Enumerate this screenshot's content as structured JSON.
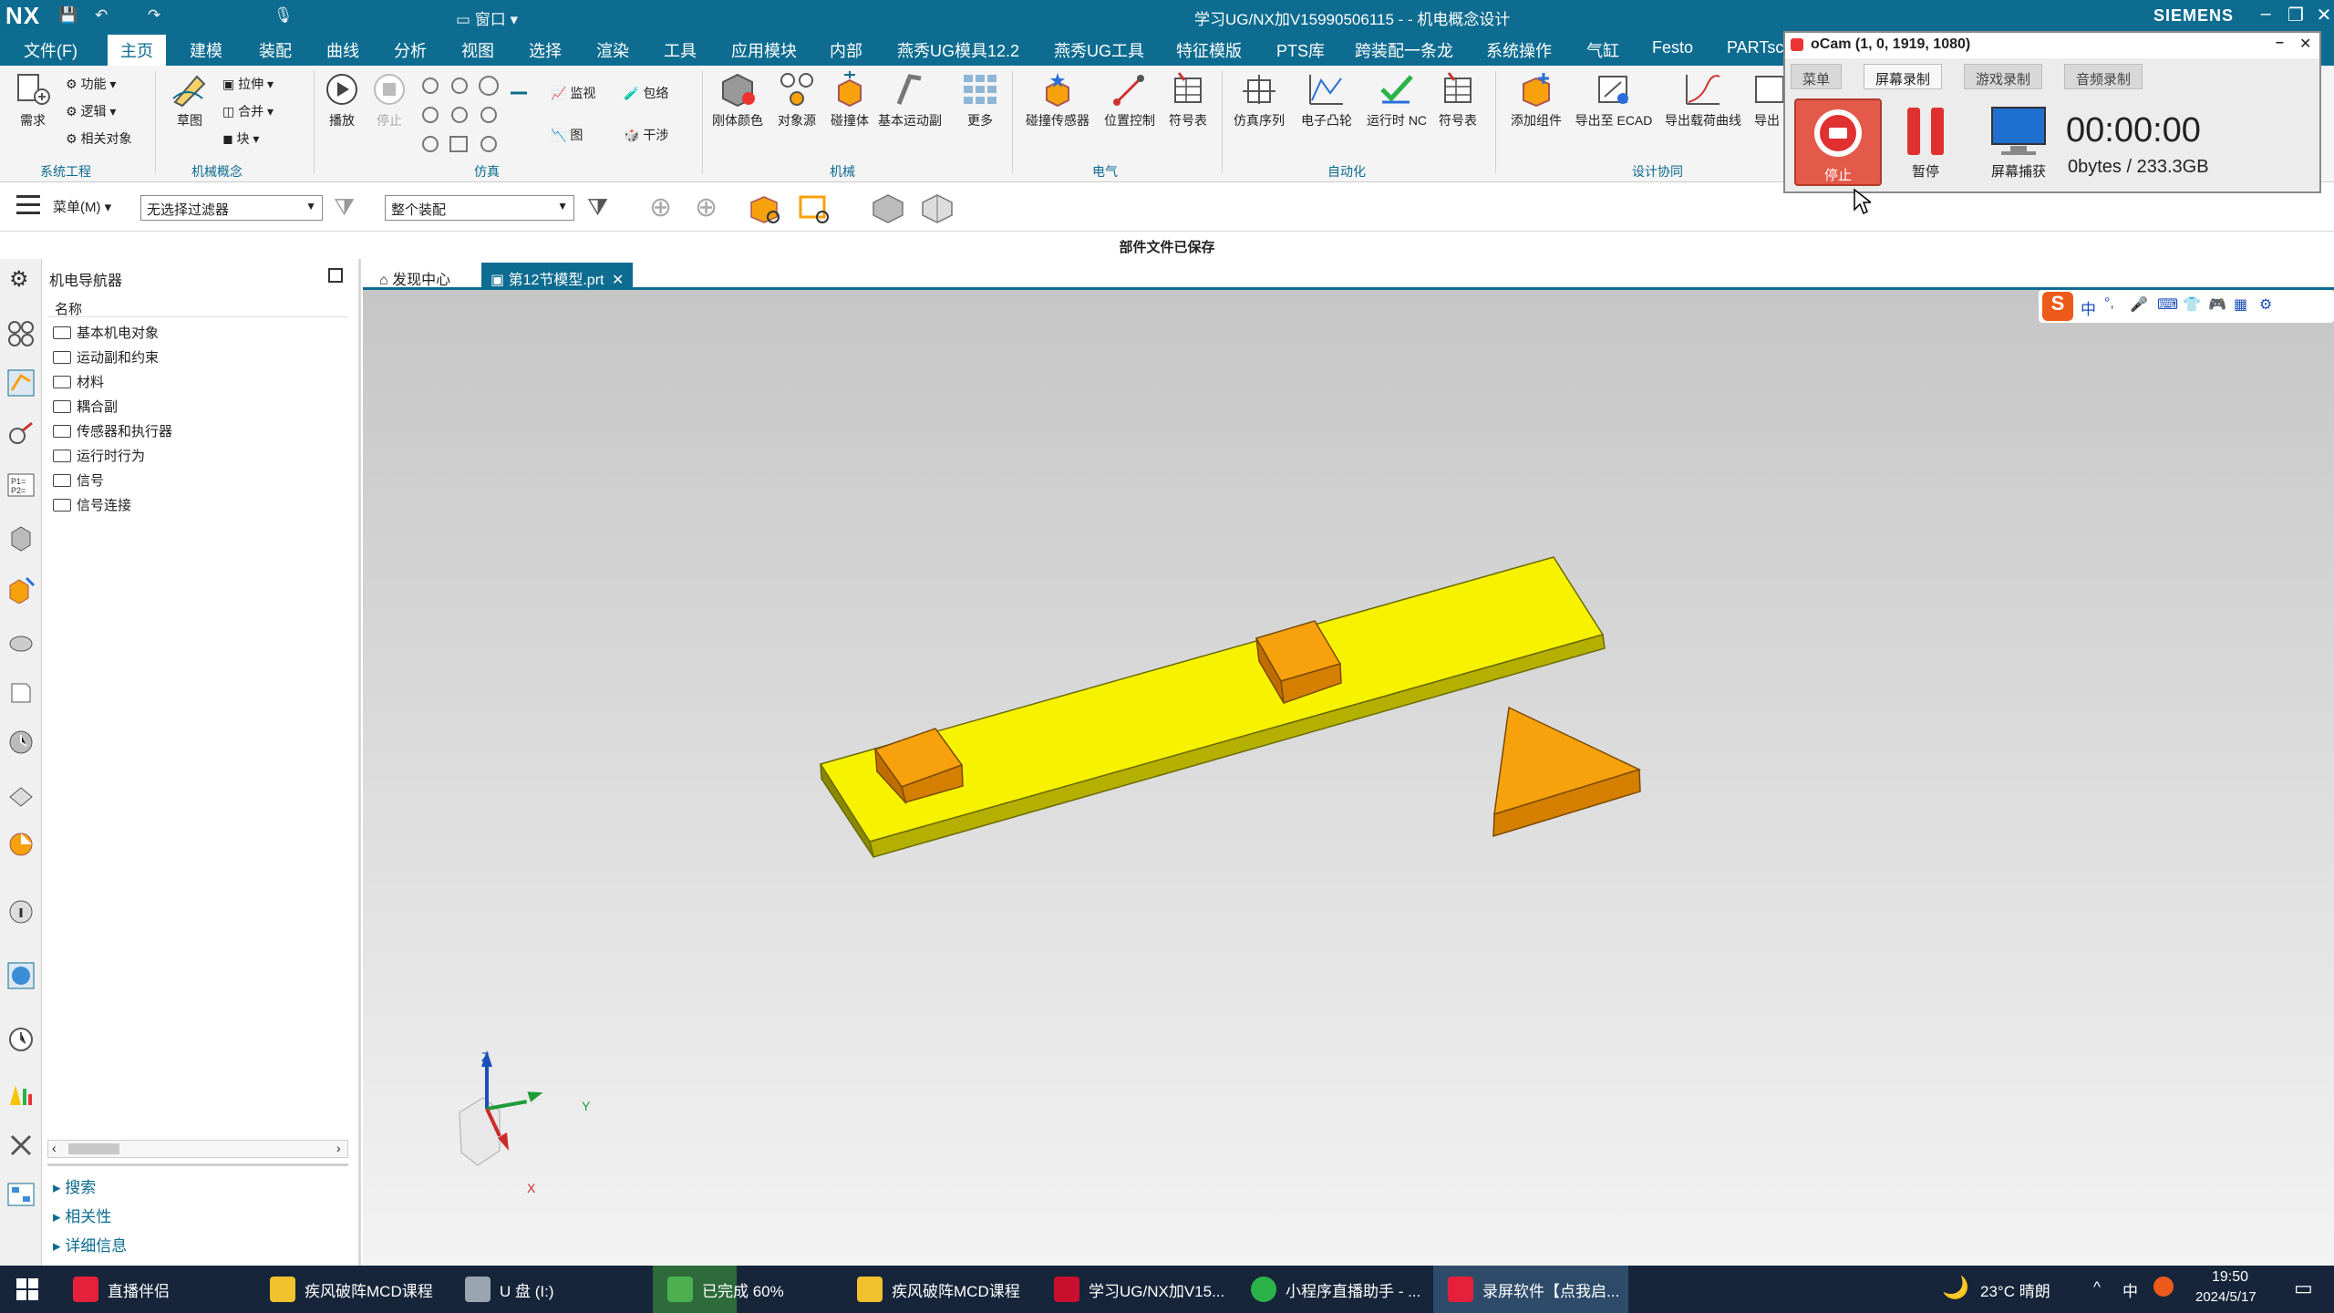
{
  "titlebar": {
    "logo": "NX",
    "title": "学习UG/NX加V15990506115 - - 机电概念设计",
    "brand": "SIEMENS",
    "quick_window": "窗口"
  },
  "menu": {
    "file": "文件(F)",
    "tabs": [
      "主页",
      "建模",
      "装配",
      "曲线",
      "分析",
      "视图",
      "选择",
      "渲染",
      "工具",
      "应用模块",
      "内部",
      "燕秀UG模具12.2",
      "燕秀UG工具",
      "特征模版",
      "PTS库",
      "跨装配一条龙",
      "系统操作",
      "气缸",
      "Festo",
      "PARTsc"
    ]
  },
  "ribbon": {
    "groups": {
      "system": "系统工程",
      "mech_concept": "机械概念",
      "simulation": "仿真",
      "mechanical": "机械",
      "electrical": "电气",
      "automation": "自动化",
      "design_collab": "设计协同"
    },
    "buttons": {
      "requirements": "需求",
      "function": "功能",
      "logic": "逻辑",
      "related_objects": "相关对象",
      "sketch": "草图",
      "extrude": "拉伸",
      "unite": "合并",
      "block": "块",
      "play": "播放",
      "stop": "停止",
      "monitor": "监视",
      "wrap": "包络",
      "graph": "图",
      "interference": "干涉",
      "rigid_color": "刚体颜色",
      "object_source": "对象源",
      "collision_body": "碰撞体",
      "basic_motion": "基本运动副",
      "more": "更多",
      "collision_sensor": "碰撞传感器",
      "position_control": "位置控制",
      "symbol_table": "符号表",
      "sim_sequence": "仿真序列",
      "electronic_cam": "电子凸轮",
      "runtime_nc": "运行时 NC",
      "symbol_table2": "符号表",
      "add_component": "添加组件",
      "export_ecad": "导出至 ECAD",
      "export_load_curve": "导出载荷曲线",
      "export_trunc": "导出"
    }
  },
  "toolbar": {
    "menu_label": "菜单(M)",
    "filter_value": "无选择过滤器",
    "assembly_value": "整个装配"
  },
  "status": {
    "message": "部件文件已保存"
  },
  "navigator": {
    "title": "机电导航器",
    "column_header": "名称",
    "items": [
      "基本机电对象",
      "运动副和约束",
      "材料",
      "耦合副",
      "传感器和执行器",
      "运行时行为",
      "信号",
      "信号连接"
    ],
    "sections": [
      "搜索",
      "相关性",
      "详细信息"
    ]
  },
  "view_tabs": {
    "discovery": "发现中心",
    "active_file": "第12节模型.prt"
  },
  "triad": {
    "z": "Z",
    "y": "Y",
    "x": "X"
  },
  "ocam": {
    "title": "oCam (1, 0, 1919, 1080)",
    "tabs": [
      "菜单",
      "屏幕录制",
      "游戏录制",
      "音频录制"
    ],
    "stop": "停止",
    "pause": "暂停",
    "capture": "屏幕捕获",
    "timer": "00:00:00",
    "storage": "0bytes / 233.3GB"
  },
  "taskbar": {
    "items": [
      "直播伴侣",
      "疾风破阵MCD课程",
      "U 盘 (I:)",
      "已完成 60%",
      "疾风破阵MCD课程",
      "学习UG/NX加V15...",
      "小程序直播助手 - ...",
      "录屏软件【点我启..."
    ],
    "weather": "23°C 晴朗",
    "ime": "中",
    "time": "19:50",
    "date": "2024/5/17",
    "progress": 0.6
  },
  "colors": {
    "nx_blue": "#0d6c90",
    "beam_yellow": "#f7f200",
    "block_orange": "#f7a10d",
    "stop_red": "#e03030"
  }
}
